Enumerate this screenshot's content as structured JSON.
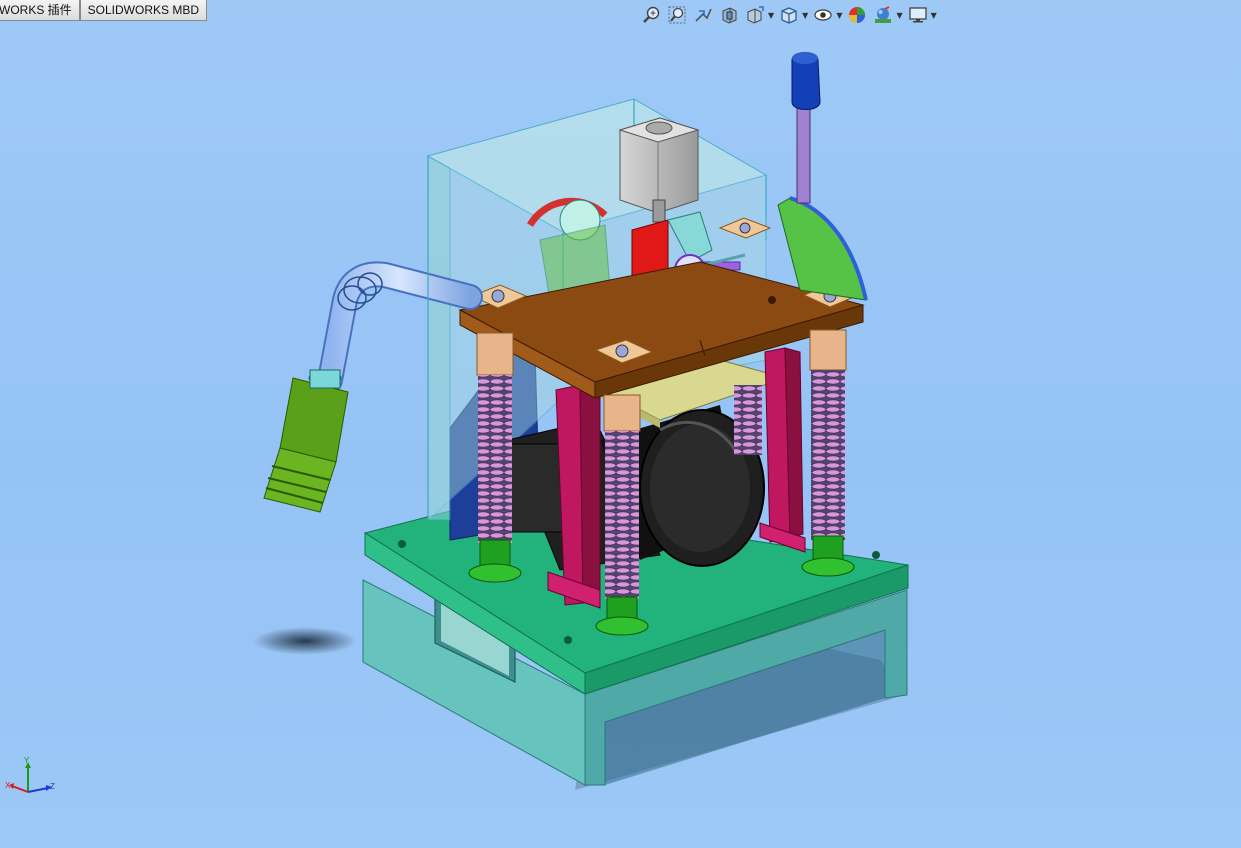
{
  "window": {
    "tabs": [
      {
        "label": "WORKS 插件"
      },
      {
        "label": "SOLIDWORKS MBD"
      }
    ]
  },
  "heads_up_toolbar": {
    "buttons": [
      {
        "icon": "zoom-to-fit-icon"
      },
      {
        "icon": "zoom-to-area-icon"
      },
      {
        "icon": "previous-view-icon"
      },
      {
        "icon": "section-view-icon"
      },
      {
        "icon": "dynamic-annotation-icon",
        "dropdown": true
      },
      {
        "icon": "view-orientation-icon",
        "dropdown": true
      },
      {
        "icon": "hide-show-items-icon",
        "dropdown": true
      },
      {
        "icon": "edit-appearance-icon"
      },
      {
        "icon": "apply-scene-icon",
        "dropdown": true
      },
      {
        "icon": "view-settings-icon",
        "dropdown": true
      }
    ]
  },
  "triad": {
    "x_label": "X",
    "y_label": "Y",
    "z_label": "Z"
  },
  "colors": {
    "background": "#96c3f6",
    "base": "#5cb8b4",
    "base_plate": "#1fb37a",
    "top_plate": "#8b4a12",
    "posts": "#e8b48a",
    "springs": "#c98ad2",
    "motor": "#1c1c1c",
    "enclosure": "#a8d8e0",
    "stepper": "#b4b4b4",
    "red_part": "#e01818",
    "sector": "#56c246",
    "handle_knob": "#1340b8",
    "handle_shaft": "#a080d0",
    "nozzle": "#5aa018"
  }
}
